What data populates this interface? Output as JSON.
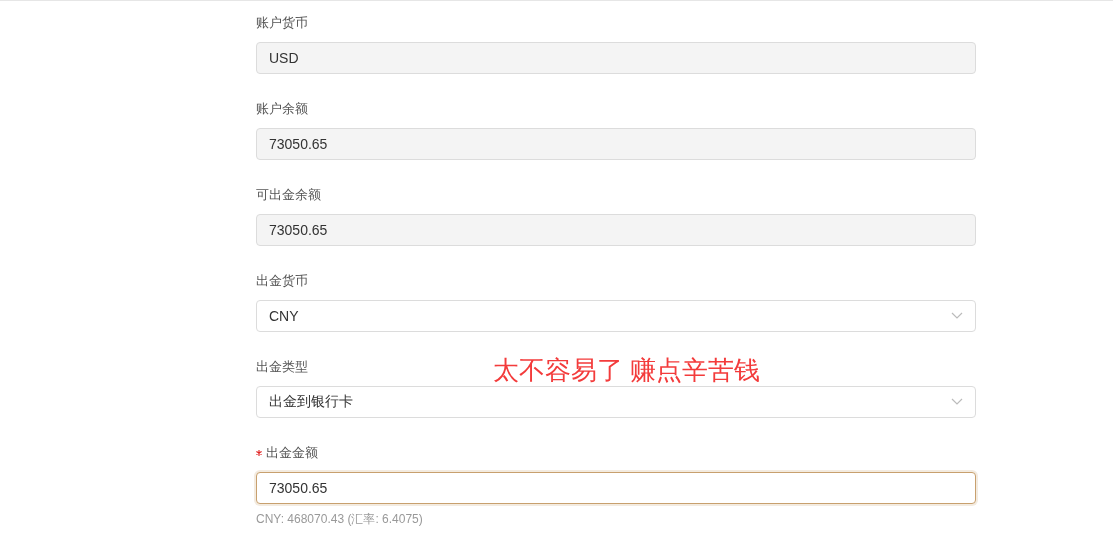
{
  "fields": [
    {
      "label": "账户货币",
      "kind": "readonly",
      "value": "USD",
      "required": false,
      "focused": false
    },
    {
      "label": "账户余额",
      "kind": "readonly",
      "value": "73050.65",
      "required": false,
      "focused": false
    },
    {
      "label": "可出金余额",
      "kind": "readonly",
      "value": "73050.65",
      "required": false,
      "focused": false
    },
    {
      "label": "出金货币",
      "kind": "select",
      "value": "CNY",
      "required": false,
      "focused": false
    },
    {
      "label": "出金类型",
      "kind": "select",
      "value": "出金到银行卡",
      "required": false,
      "focused": false
    },
    {
      "label": "出金金额",
      "kind": "input",
      "value": "73050.65",
      "required": true,
      "focused": true,
      "hint": "CNY: 468070.43 (汇率: 6.4075)"
    }
  ],
  "annotation": "太不容易了 赚点辛苦钱"
}
